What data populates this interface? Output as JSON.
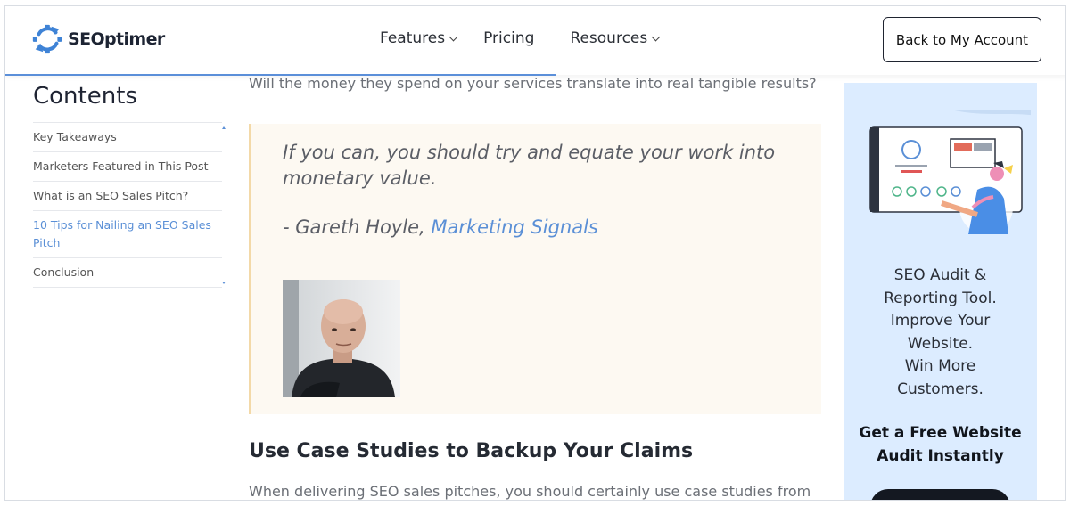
{
  "header": {
    "logo_text": "SEOptimer",
    "nav": [
      {
        "label": "Features",
        "has_dropdown": true
      },
      {
        "label": "Pricing",
        "has_dropdown": false
      },
      {
        "label": "Resources",
        "has_dropdown": true
      }
    ],
    "account_button": "Back to My Account",
    "reading_progress": 0.52
  },
  "sidebar": {
    "title": "Contents",
    "items": [
      {
        "label": "Key Takeaways",
        "active": false
      },
      {
        "label": "Marketers Featured in This Post",
        "active": false
      },
      {
        "label": "What is an SEO Sales Pitch?",
        "active": false
      },
      {
        "label": "10 Tips for Nailing an SEO Sales Pitch",
        "active": true
      },
      {
        "label": "Conclusion",
        "active": false
      }
    ]
  },
  "article": {
    "lead_text": "Will the money they spend on your services translate into real tangible results?",
    "quote": {
      "text": "If you can, you should try and equate your work into monetary value.",
      "author_prefix": "- Gareth Hoyle, ",
      "author_link": "Marketing Signals"
    },
    "heading": "Use Case Studies to Backup Your Claims",
    "paragraph": "When delivering SEO sales pitches, you should certainly use case studies from"
  },
  "ad": {
    "lines": [
      "SEO Audit &",
      "Reporting Tool.",
      "Improve Your",
      "Website.",
      "Win More",
      "Customers."
    ],
    "cta": [
      "Get a Free Website",
      "Audit Instantly"
    ]
  },
  "colors": {
    "accent": "#5a8fd6",
    "quote_bg": "#fdf9f2",
    "quote_border": "#f3d9a8",
    "ad_bg": "#dcecff"
  }
}
